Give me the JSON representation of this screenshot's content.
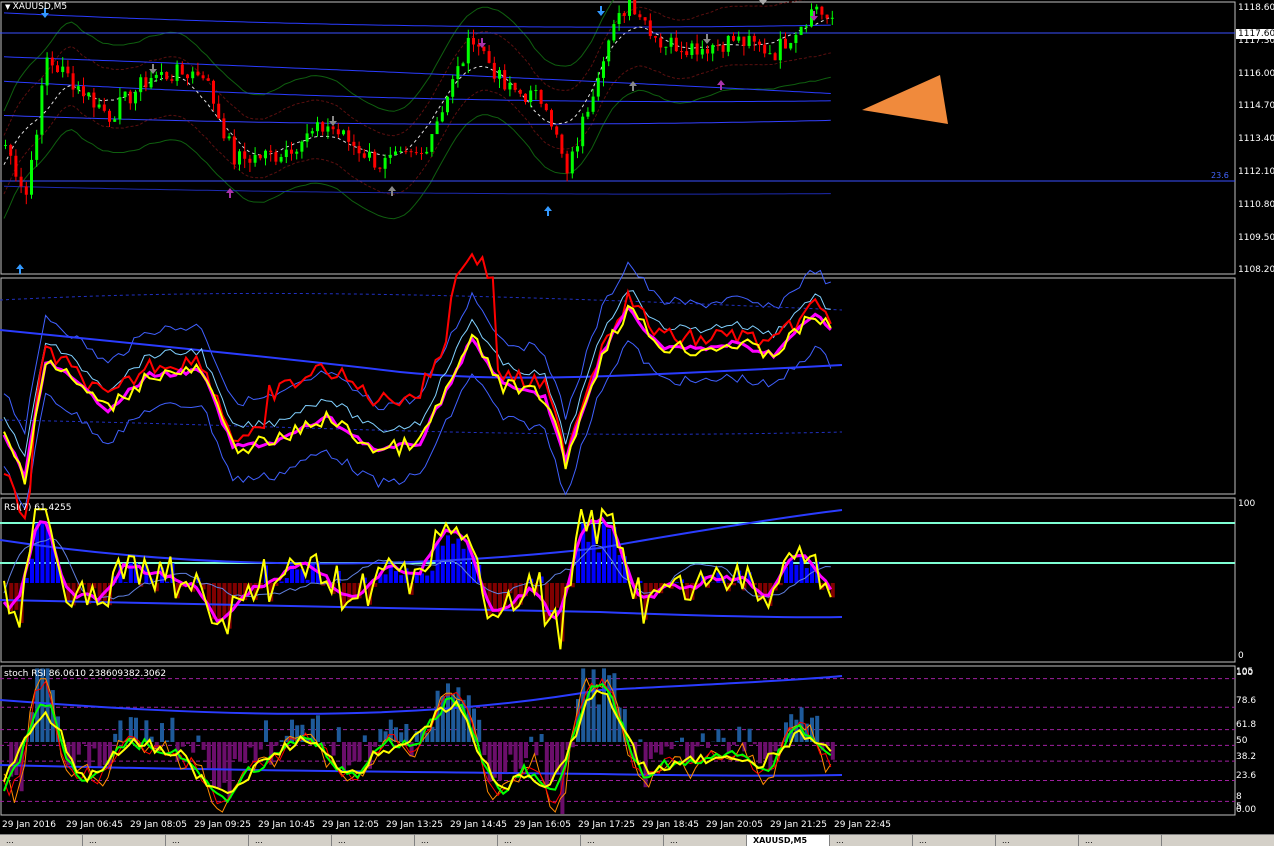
{
  "symbol_title": "XAUUSD,M5",
  "rsi_header": "RSI(7) 61.4255",
  "stoch_header": "stoch RSI 86.0610 238609382.3062",
  "fib_label": "23.6",
  "current_price_tag": "1117.60",
  "price_axis": [
    "1118.60",
    "1117.30",
    "1116.00",
    "1114.70",
    "1113.40",
    "1112.10",
    "1110.80",
    "1109.50",
    "1108.20"
  ],
  "rsi_axis": [
    "100",
    "0"
  ],
  "stoch_axis": [
    "105",
    "100",
    "78.6",
    "61.8",
    "50",
    "38.2",
    "23.6",
    "8",
    "5",
    "0.00"
  ],
  "time_axis": [
    "29 Jan 2016",
    "29 Jan 06:45",
    "29 Jan 08:05",
    "29 Jan 09:25",
    "29 Jan 10:45",
    "29 Jan 12:05",
    "29 Jan 13:25",
    "29 Jan 14:45",
    "29 Jan 16:05",
    "29 Jan 17:25",
    "29 Jan 18:45",
    "29 Jan 20:05",
    "29 Jan 21:25",
    "29 Jan 22:45"
  ],
  "tabs": [
    "...",
    "...",
    "...",
    "...",
    "...",
    "...",
    "...",
    "...",
    "...",
    "XAUUSD,M5",
    "...",
    "...",
    "...",
    "..."
  ],
  "colors": {
    "bull_candle": "#00ff00",
    "bear_candle": "#ff0000",
    "yellow_line": "#ffff00",
    "magenta_line": "#ff00ff",
    "band_blue": "#3050ff",
    "cyan_level": "#7fffd4",
    "hist_blue": "#0000ff",
    "hist_darkred": "#800000",
    "hist_purple": "#6b0e6b",
    "hist_steel": "#1e5a9a",
    "orange_triangle": "#f08a3c"
  },
  "icons": [
    "arrow-down-icon",
    "arrow-up-icon",
    "orange-triangle-icon"
  ]
}
